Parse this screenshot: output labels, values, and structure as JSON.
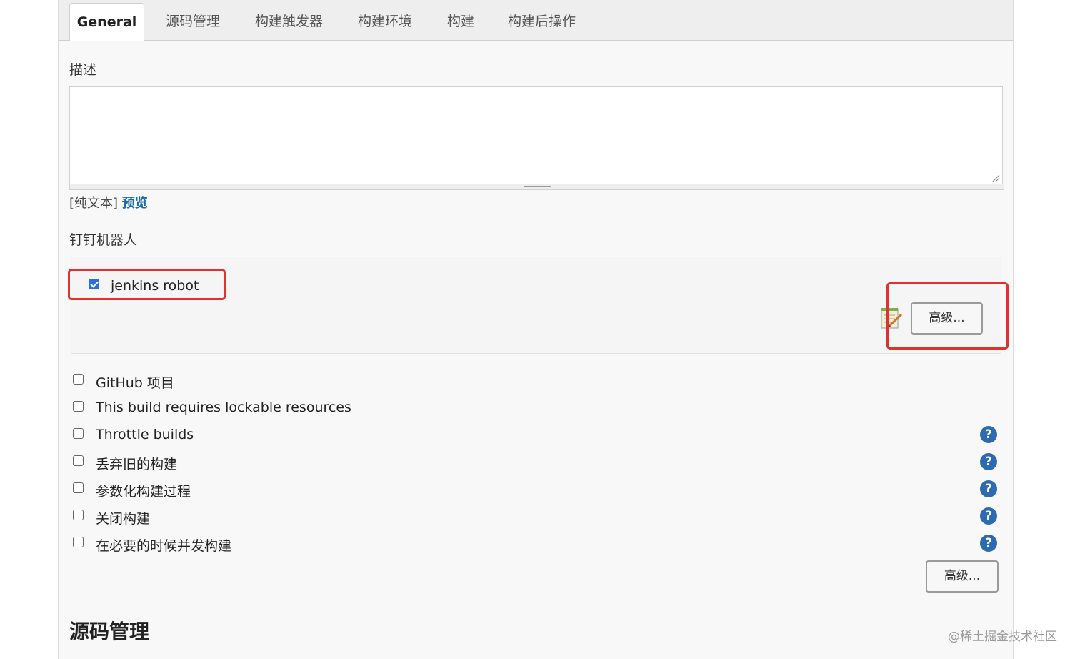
{
  "tabs": [
    "General",
    "源码管理",
    "构建触发器",
    "构建环境",
    "构建",
    "构建后操作"
  ],
  "description": {
    "label": "描述",
    "value": "",
    "format_plain": "[纯文本]",
    "format_preview": "预览"
  },
  "dingtalk": {
    "label": "钉钉机器人",
    "robot_name": "jenkins robot",
    "robot_checked": true,
    "advanced_label": "高级..."
  },
  "options": [
    {
      "label": "GitHub 项目",
      "checked": false,
      "help": false
    },
    {
      "label": "This build requires lockable resources",
      "checked": false,
      "help": false
    },
    {
      "label": "Throttle builds",
      "checked": false,
      "help": true
    },
    {
      "label": "丢弃旧的构建",
      "checked": false,
      "help": true
    },
    {
      "label": "参数化构建过程",
      "checked": false,
      "help": true
    },
    {
      "label": "关闭构建",
      "checked": false,
      "help": true
    },
    {
      "label": "在必要的时候并发构建",
      "checked": false,
      "help": true
    }
  ],
  "general_advanced_label": "高级...",
  "next_section_title": "源码管理",
  "watermark": "@稀土掘金技术社区",
  "colors": {
    "accent": "#2b6fe0",
    "highlight": "#e0312f",
    "help": "#2d6ab0",
    "link": "#1a6aa8"
  }
}
